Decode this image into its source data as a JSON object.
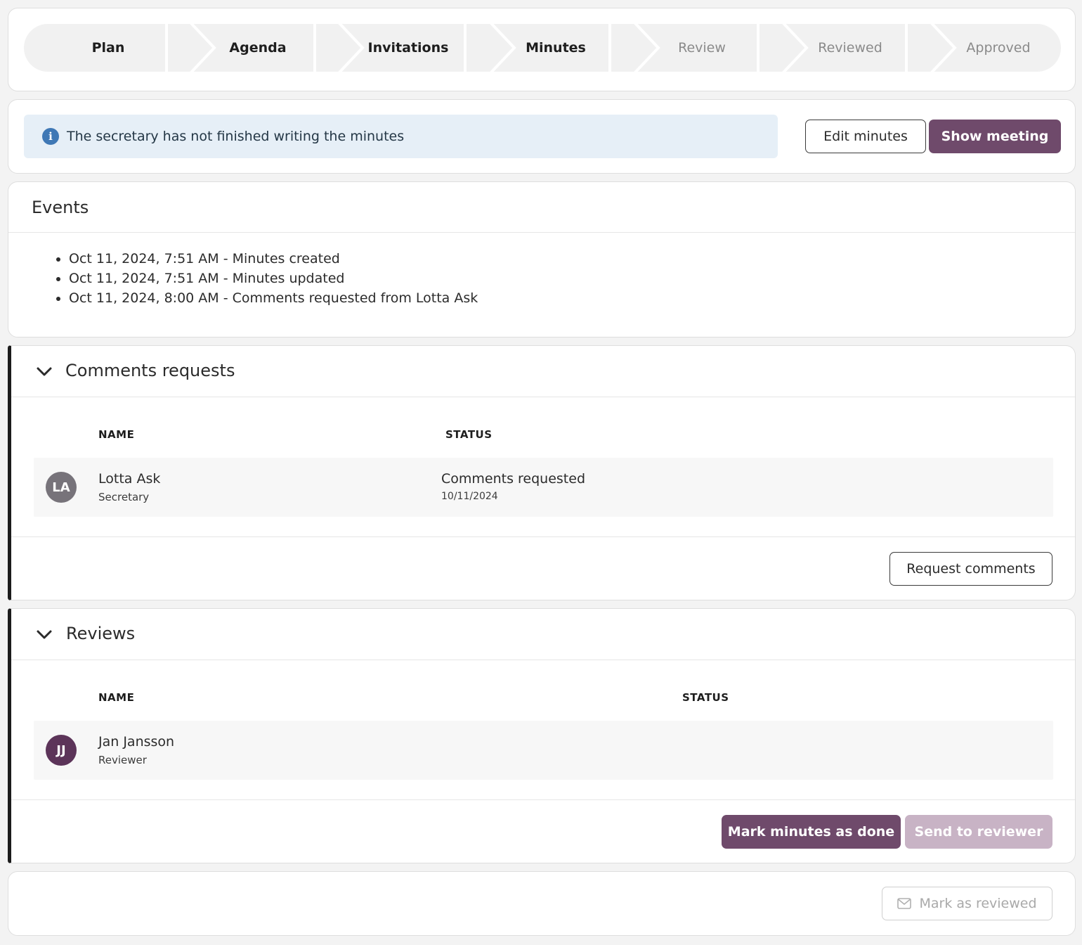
{
  "stepper": {
    "steps": [
      {
        "label": "Plan",
        "state": "done"
      },
      {
        "label": "Agenda",
        "state": "done"
      },
      {
        "label": "Invitations",
        "state": "done"
      },
      {
        "label": "Minutes",
        "state": "done"
      },
      {
        "label": "Review",
        "state": "todo"
      },
      {
        "label": "Reviewed",
        "state": "todo"
      },
      {
        "label": "Approved",
        "state": "todo"
      }
    ]
  },
  "banner": {
    "message": "The secretary has not finished writing the minutes",
    "icon": "info-icon",
    "edit_label": "Edit minutes",
    "show_label": "Show meeting"
  },
  "events": {
    "title": "Events",
    "items": [
      "Oct 11, 2024, 7:51 AM - Minutes created",
      "Oct 11, 2024, 7:51 AM - Minutes updated",
      "Oct 11, 2024, 8:00 AM - Comments requested from Lotta Ask"
    ]
  },
  "comments": {
    "title": "Comments requests",
    "col_name": "NAME",
    "col_status": "STATUS",
    "rows": [
      {
        "initials": "LA",
        "name": "Lotta Ask",
        "role": "Secretary",
        "status": "Comments requested",
        "status_date": "10/11/2024"
      }
    ],
    "request_label": "Request comments"
  },
  "reviews": {
    "title": "Reviews",
    "col_name": "NAME",
    "col_status": "STATUS",
    "rows": [
      {
        "initials": "JJ",
        "name": "Jan Jansson",
        "role": "Reviewer"
      }
    ],
    "mark_done_label": "Mark minutes as done",
    "send_label": "Send to reviewer"
  },
  "footer": {
    "mark_reviewed_label": "Mark as reviewed",
    "icon": "envelope-icon"
  },
  "colors": {
    "primary": "#6f4a6b",
    "primary_disabled": "#c8b3c5",
    "info_bg": "#e6eff7",
    "info_icon": "#3f78b5",
    "avatar_la": "#77737a",
    "avatar_jj": "#5c3459"
  }
}
